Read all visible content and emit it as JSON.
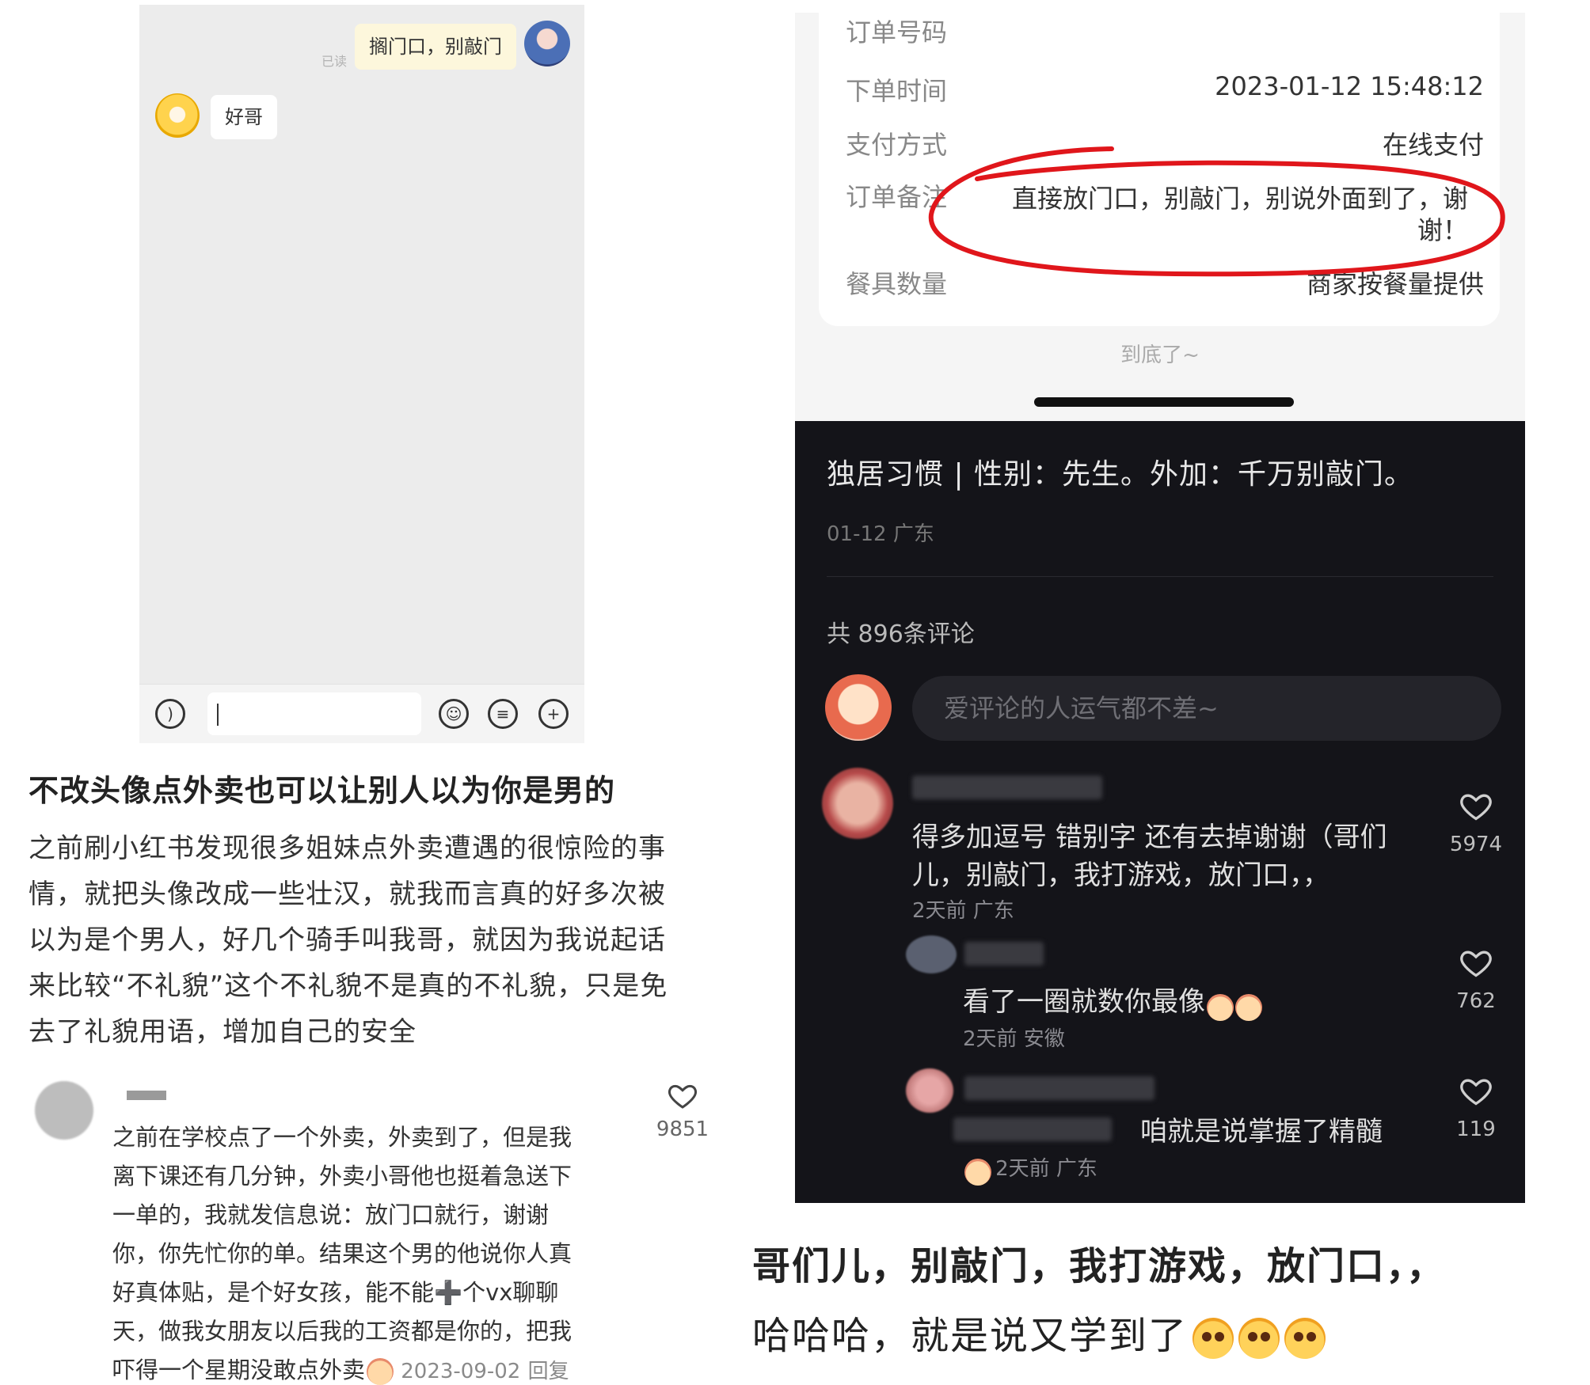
{
  "chat": {
    "read_status": "已读",
    "my_message": "搁门口，别敲门",
    "their_message": "好哥"
  },
  "post": {
    "title": "不改头像点外卖也可以让别人以为你是男的",
    "body_lines": [
      "之前刷小红书发现很多姐妹点外卖遭遇的很惊险的事",
      "情，就把头像改成一些壮汉，就我而言真的好多次被",
      "以为是个男人，好几个骑手叫我哥，就因为我说起话",
      "来比较“不礼貌”这个不礼貌不是真的不礼貌，只是免",
      "去了礼貌用语，增加自己的安全"
    ]
  },
  "left_comment": {
    "lines": [
      "之前在学校点了一个外卖，外卖到了，但是我",
      "离下课还有几分钟，外卖小哥他也挺着急送下",
      "一单的，我就发信息说：放门口就行，谢谢",
      "你，你先忙你的单。结果这个男的他说你人真",
      "好真体贴，是个好女孩，能不能➕个vx聊聊",
      "天，做我女朋友以后我的工资都是你的，把我",
      "吓得一个星期没敢点外卖"
    ],
    "date": "2023-09-02",
    "reply": "回复",
    "likes": "9851"
  },
  "order": {
    "rows": [
      {
        "label": "订单号码",
        "value": ""
      },
      {
        "label": "下单时间",
        "value": "2023-01-12 15:48:12"
      },
      {
        "label": "支付方式",
        "value": "在线支付"
      },
      {
        "label": "订单备注",
        "value": "直接放门口，别敲门，别说外面到了，谢"
      },
      {
        "label": "",
        "value": "谢！"
      },
      {
        "label": "餐具数量",
        "value": "商家按餐量提供"
      }
    ],
    "bottom_text": "到底了~",
    "highlight_color": "#e0161b"
  },
  "dark": {
    "post_desc": "独居习惯 | 性别：先生。外加：千万别敲门。",
    "post_meta": "01-12 广东",
    "comment_count": "共 896条评论",
    "input_placeholder": "爱评论的人运气都不差~",
    "comments": [
      {
        "text1": "得多加逗号 错别字 还有去掉谢谢（哥们",
        "text2": "儿，别敲门，我打游戏，放门口，，",
        "meta": "2天前  广东",
        "likes": "5974"
      },
      {
        "text1": "看了一圈就数你最像",
        "meta": "2天前  安徽",
        "likes": "762"
      },
      {
        "text1": "咱就是说掌握了精髓",
        "meta": "2天前  广东",
        "likes": "119"
      }
    ]
  },
  "caption": {
    "line1": "哥们儿，别敲门，我打游戏，放门口，，",
    "line2": "哈哈哈，就是说又学到了"
  }
}
